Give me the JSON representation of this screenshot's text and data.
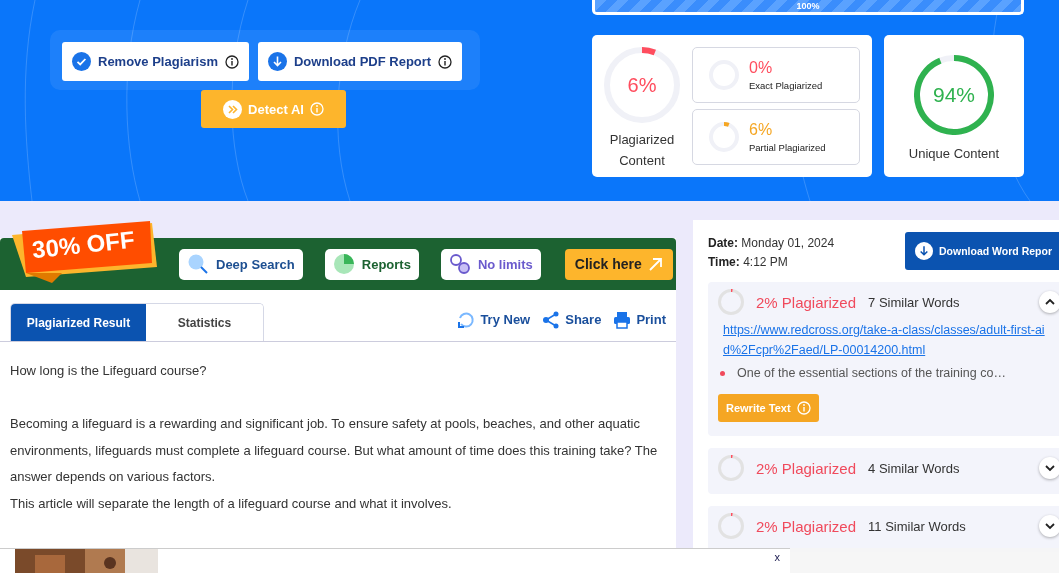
{
  "progress": {
    "level": 1,
    "label": "100%"
  },
  "actions": {
    "remove": "Remove Plagiarism",
    "download_pdf": "Download PDF Report",
    "detect_ai": "Detect AI"
  },
  "summary": {
    "plagiarized": {
      "value": "6%",
      "label": "Plagiarized Content"
    },
    "breakdown": [
      {
        "value": "0%",
        "label": "Exact Plagiarized",
        "color": "#ff4d5e"
      },
      {
        "value": "6%",
        "label": "Partial Plagiarized",
        "color": "#f5a623"
      }
    ],
    "unique": {
      "value": "94%",
      "label": "Unique Content"
    }
  },
  "promo": {
    "badge": "30% OFF",
    "features": [
      {
        "kind": "search",
        "label": "Deep Search"
      },
      {
        "kind": "reports",
        "label": "Reports"
      },
      {
        "kind": "limits",
        "label": "No limits"
      }
    ],
    "cta": "Click here"
  },
  "tabs": [
    {
      "label": "Plagiarized Result",
      "selected": true
    },
    {
      "label": "Statistics",
      "selected": false
    }
  ],
  "tools": [
    {
      "kind": "refresh",
      "label": "Try New"
    },
    {
      "kind": "share",
      "label": "Share"
    },
    {
      "kind": "print",
      "label": "Print"
    }
  ],
  "content": [
    "How long is the Lifeguard course?",
    "Becoming a lifeguard is a rewarding and significant job. To ensure safety at pools, beaches, and other aquatic environments, lifeguards must complete a lifeguard course. But what amount of time does this training take? The answer depends on various factors.",
    "This article will separate the length of a lifeguard course and what it involves."
  ],
  "report": {
    "date_label": "Date:",
    "date": "Monday 01, 2024",
    "time_label": "Time:",
    "time": "4:12 PM",
    "download": "Download Word Repor"
  },
  "sources": [
    {
      "percent": "2% Plagiarized",
      "words": "7 Similar Words",
      "expanded": true,
      "url": "https://www.redcross.org/take-a-class/classes/adult-first-aid%2Fcpr%2Faed/LP-00014200.html",
      "snippet": "One of the essential sections of the training co…",
      "action": "Rewrite Text"
    },
    {
      "percent": "2% Plagiarized",
      "words": "4 Similar Words",
      "expanded": false
    },
    {
      "percent": "2% Plagiarized",
      "words": "11 Similar Words",
      "expanded": false
    }
  ],
  "ad": {
    "close": "x"
  }
}
